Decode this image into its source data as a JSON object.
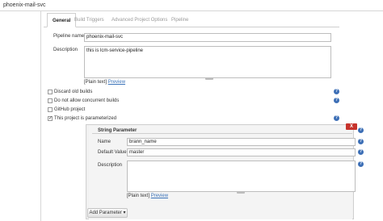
{
  "breadcrumb": {
    "project": "phoenix-mail-svc"
  },
  "tabs": [
    {
      "label": "General"
    },
    {
      "label": "Build Triggers"
    },
    {
      "label": "Advanced Project Options"
    },
    {
      "label": "Pipeline"
    }
  ],
  "general": {
    "pipeline_name_label": "Pipeline name",
    "pipeline_name_value": "phoenix-mail-svc",
    "description_label": "Description",
    "description_value": "this is lcm-service-pipeline",
    "plain_text": "[Plain text]",
    "preview": "Preview"
  },
  "options": [
    {
      "label": "Discard old builds",
      "checked": false
    },
    {
      "label": "Do not allow concurrent builds",
      "checked": false
    },
    {
      "label": "GitHub project",
      "checked": false
    },
    {
      "label": "This project is parameterized",
      "checked": true
    }
  ],
  "parameter": {
    "title": "String Parameter",
    "delete_label": "X",
    "name_label": "Name",
    "name_value": "brann_name",
    "default_label": "Default Value",
    "default_value": "master",
    "description_label": "Description",
    "description_value": "",
    "plain_text": "[Plain text]",
    "preview": "Preview"
  },
  "add_parameter": {
    "label": "Add Parameter",
    "caret": "▾"
  },
  "help_glyph": "?",
  "colors": {
    "link": "#3b73b9",
    "help": "#3d6fb6",
    "delete": "#c7332c"
  }
}
